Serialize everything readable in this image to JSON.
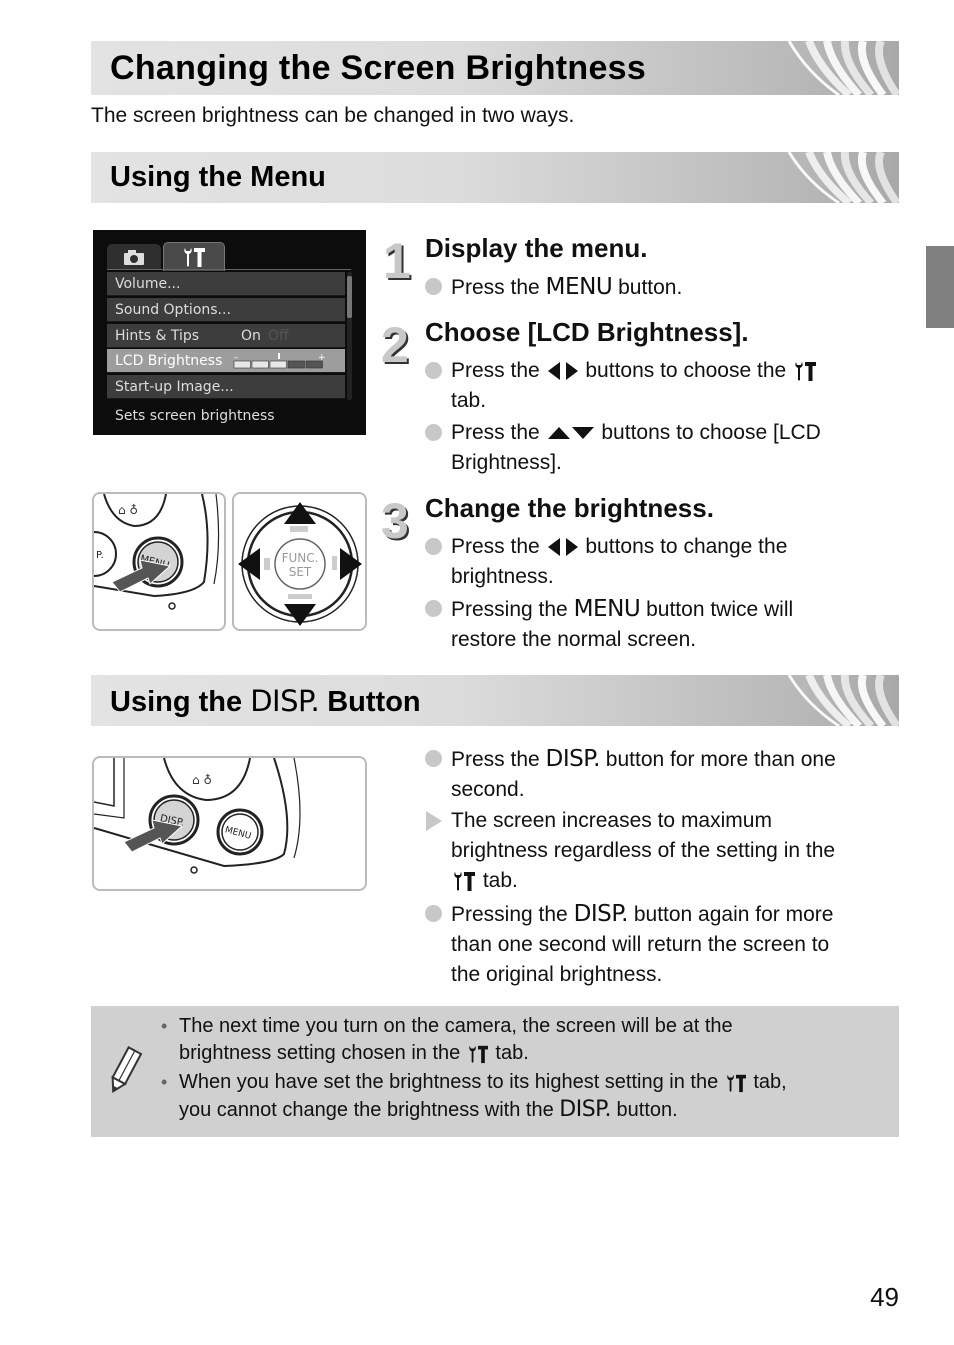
{
  "page": {
    "title": "Changing the Screen Brightness",
    "intro": "The screen brightness can be changed in two ways.",
    "page_number": "49",
    "side_tab_color": "#808080"
  },
  "sections": {
    "menu": {
      "heading": "Using the Menu"
    },
    "disp": {
      "heading_prefix": "Using the",
      "heading_glyph": "DISP.",
      "heading_suffix": "Button"
    }
  },
  "lcd_screen": {
    "tabs": [
      {
        "icon": "camera-icon",
        "selected": false
      },
      {
        "icon": "wrench-hammer-icon",
        "selected": true
      }
    ],
    "items": [
      {
        "label": "Volume..."
      },
      {
        "label": "Sound Options..."
      },
      {
        "label": "Hints & Tips",
        "value": "On",
        "alt_value": "Off"
      },
      {
        "label": "LCD Brightness",
        "selected": true,
        "scale_min": "–",
        "scale_max": "+"
      },
      {
        "label": "Start-up Image..."
      }
    ],
    "brightness_level": 3,
    "brightness_max": 5,
    "footer": "Sets screen brightness"
  },
  "steps": [
    {
      "number": "1",
      "title": "Display the menu.",
      "bullets": [
        {
          "type": "dot",
          "parts": [
            "Press the ",
            "MENU",
            " button."
          ]
        }
      ]
    },
    {
      "number": "2",
      "title": "Choose [LCD Brightness].",
      "bullets": [
        {
          "type": "dot",
          "parts": [
            "Press the ",
            "◀▶",
            " buttons to choose the ",
            "wrench-tab",
            " tab."
          ]
        },
        {
          "type": "dot",
          "parts": [
            "Press the ",
            "▲▼",
            " buttons to choose [LCD Brightness]."
          ]
        }
      ]
    },
    {
      "number": "3",
      "title": "Change the brightness.",
      "bullets": [
        {
          "type": "dot",
          "parts": [
            "Press the ",
            "◀▶",
            " buttons to change the brightness."
          ]
        },
        {
          "type": "dot",
          "parts": [
            "Pressing the ",
            "MENU",
            " button twice will restore the normal screen."
          ]
        }
      ]
    }
  ],
  "text": {
    "s1b1_a": "Press the ",
    "s1b1_glyph": "MENU",
    "s1b1_b": " button.",
    "s2b1_a": "Press the ",
    "s2b1_b": " buttons to choose the ",
    "s2b1_c": "tab.",
    "s2b2_a": "Press the ",
    "s2b2_b": " buttons to choose [LCD",
    "s2b2_c": "Brightness].",
    "s3b1_a": "Press the ",
    "s3b1_b": " buttons to change the",
    "s3b1_c": "brightness.",
    "s3b2_a": "Pressing the ",
    "s3b2_glyph": "MENU",
    "s3b2_b": " button twice will",
    "s3b2_c": "restore the normal screen.",
    "d1_a": "Press the ",
    "d1_glyph": "DISP.",
    "d1_b": " button for more than one",
    "d1_c": "second.",
    "d2_a": "The screen increases to maximum",
    "d2_b": "brightness regardless of the setting in the",
    "d2_c": " tab.",
    "d3_a": "Pressing the ",
    "d3_glyph": "DISP.",
    "d3_b": " button again for more",
    "d3_c": "than one second will return the screen to",
    "d3_d": "the original brightness."
  },
  "illustrations": {
    "menu_button_label": "MENU",
    "func_set_label_1": "FUNC.",
    "func_set_label_2": "SET",
    "disp_button_label": "DISP.",
    "disp_menu_button_label": "MENU",
    "partial_button_label": "P."
  },
  "note": {
    "icon": "pencil-icon",
    "items": [
      {
        "a": "The next time you turn on the camera, the screen will be at the",
        "b": "brightness setting chosen in the ",
        "c": " tab."
      },
      {
        "a": "When you have set the brightness to its highest setting in the ",
        "a2": " tab,",
        "b": "you cannot change the brightness with the ",
        "glyph": "DISP.",
        "c": " button."
      }
    ]
  }
}
